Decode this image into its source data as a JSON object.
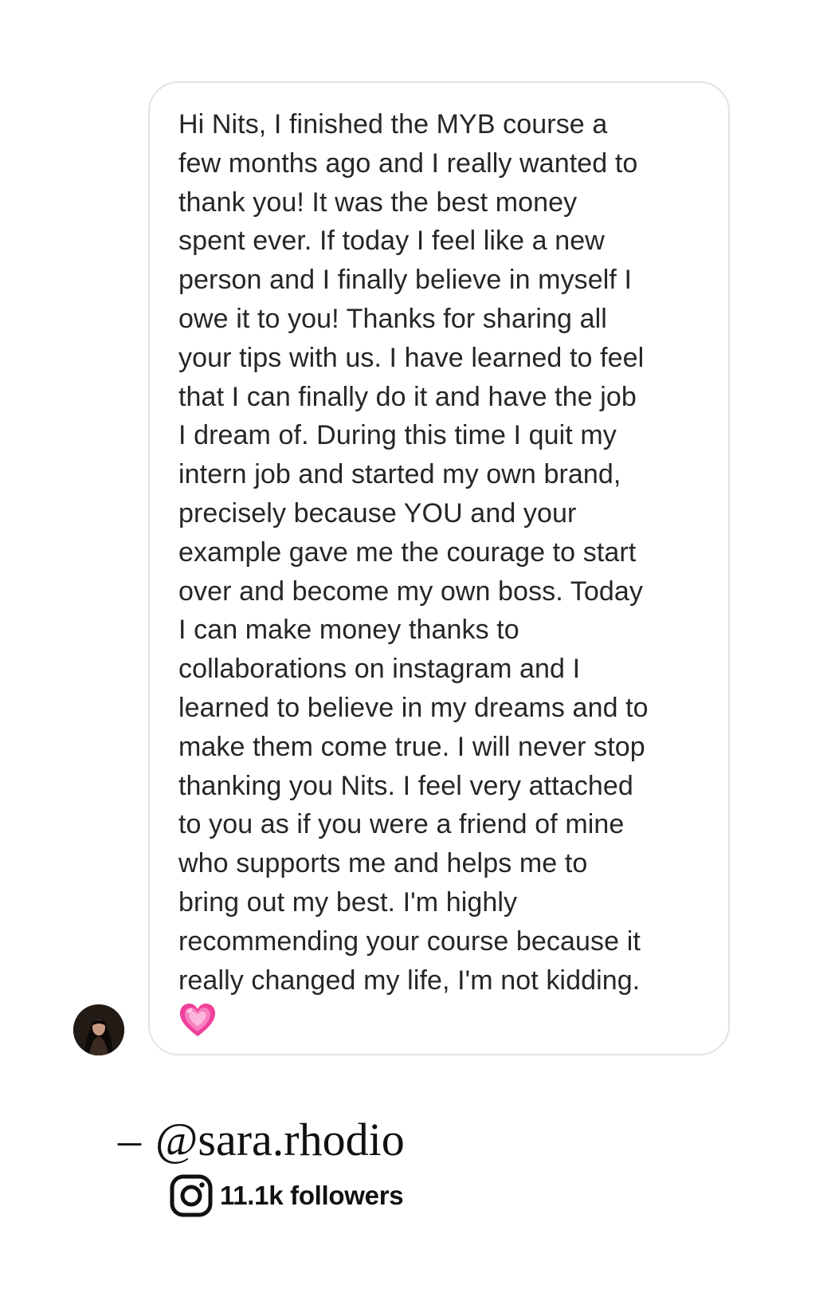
{
  "message": {
    "lines": [
      "Hi Nits, I finished the MYB course a",
      "few months ago and I really wanted to",
      "thank you! It was the best money",
      "spent ever. If today I feel like a new",
      "person and I finally believe in myself I",
      "owe it to you! Thanks for sharing all",
      "your tips with us. I have learned to feel",
      "that I can finally do it and have the job",
      "I dream of. During this time I quit my",
      "intern job and started my own brand,",
      "precisely because YOU and your",
      "example gave me the courage to start",
      "over and become my own boss. Today",
      "I can make money thanks to",
      "collaborations on instagram and I",
      "learned to believe in my dreams and to",
      "make them come true. I will never stop",
      "thanking you Nits. I feel very attached",
      "to you as if you were a friend of mine",
      "who supports me and helps me to",
      "bring out my best. I'm highly",
      "recommending your course because it",
      "really changed my life, I'm not kidding."
    ],
    "emoji": "growing-heart-icon"
  },
  "attribution": {
    "dash": "–",
    "handle": "@sara.rhodio"
  },
  "followers": {
    "icon": "instagram-icon",
    "count_label": "11.1k followers"
  },
  "colors": {
    "text": "#262626",
    "bubble_border": "#e3e3e3",
    "heart": "#f0409a"
  }
}
